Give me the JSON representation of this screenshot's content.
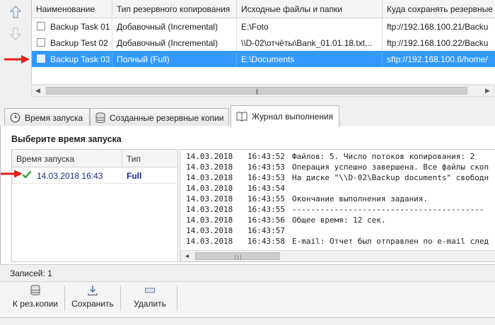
{
  "tasks_grid": {
    "columns": [
      "Наименование",
      "Тип резервного копирования",
      "Исходные файлы и папки",
      "Куда сохранять резервные"
    ],
    "rows": [
      {
        "name": "Backup Task 01",
        "type": "Добавочный (Incremental)",
        "source": "E:\\Foto",
        "dest": "ftp://192.168.100.21/Backu"
      },
      {
        "name": "Backup Test 02",
        "type": "Добавочный (Incremental)",
        "source": "\\\\D-02\\отчёты\\Bank_01.01.18.txt...",
        "dest": "ftp://192.168.100.22/Backu"
      },
      {
        "name": "Backup Task 03",
        "type": "Полный (Full)",
        "source": "E:\\Documents",
        "dest": "sftp://192.168.100.6/home/"
      }
    ],
    "selected_index": 2
  },
  "tabs": [
    {
      "label": "Время запуска",
      "icon": "clock-icon"
    },
    {
      "label": "Созданные резервные копии",
      "icon": "database-icon"
    },
    {
      "label": "Журнал выполнения",
      "icon": "book-icon",
      "active": true
    }
  ],
  "runs_panel": {
    "title": "Выберите время запуска",
    "columns": [
      "Время запуска",
      "Тип"
    ],
    "rows": [
      {
        "time": "14.03.2018  16:43",
        "type": "Full",
        "status_icon": "check-icon"
      }
    ]
  },
  "log": [
    {
      "date": "14.03.2018",
      "time": "16:43:52",
      "msg": "Файлов: 5. Число потоков копирования: 2"
    },
    {
      "date": "14.03.2018",
      "time": "16:43:53",
      "msg": "Операция успешно завершена. Все файлы скоп"
    },
    {
      "date": "14.03.2018",
      "time": "16:43:53",
      "msg": "На диске \"\\\\D-02\\Backup documents\" свободн"
    },
    {
      "date": "14.03.2018",
      "time": "16:43:54",
      "msg": ""
    },
    {
      "date": "14.03.2018",
      "time": "16:43:55",
      "msg": "Окончание выполнения задания."
    },
    {
      "date": "14.03.2018",
      "time": "16:43:55",
      "msg": "-----------------------------------------"
    },
    {
      "date": "14.03.2018",
      "time": "16:43:56",
      "msg": "Общее время: 12 сек."
    },
    {
      "date": "14.03.2018",
      "time": "16:43:57",
      "msg": ""
    },
    {
      "date": "14.03.2018",
      "time": "16:43:58",
      "msg": "E-mail: Отчет был отправлен по e-mail след"
    }
  ],
  "status": {
    "records": "Записей: 1"
  },
  "toolbar": [
    {
      "label": "К рез.копии",
      "icon": "database-icon"
    },
    {
      "label": "Сохранить",
      "icon": "download-icon"
    },
    {
      "label": "Удалить",
      "icon": "delete-icon"
    }
  ],
  "colors": {
    "selection": "#3399ff",
    "check": "#2aa02a",
    "annotation_arrow": "#e0201c",
    "run_text": "#1a2a8a"
  }
}
